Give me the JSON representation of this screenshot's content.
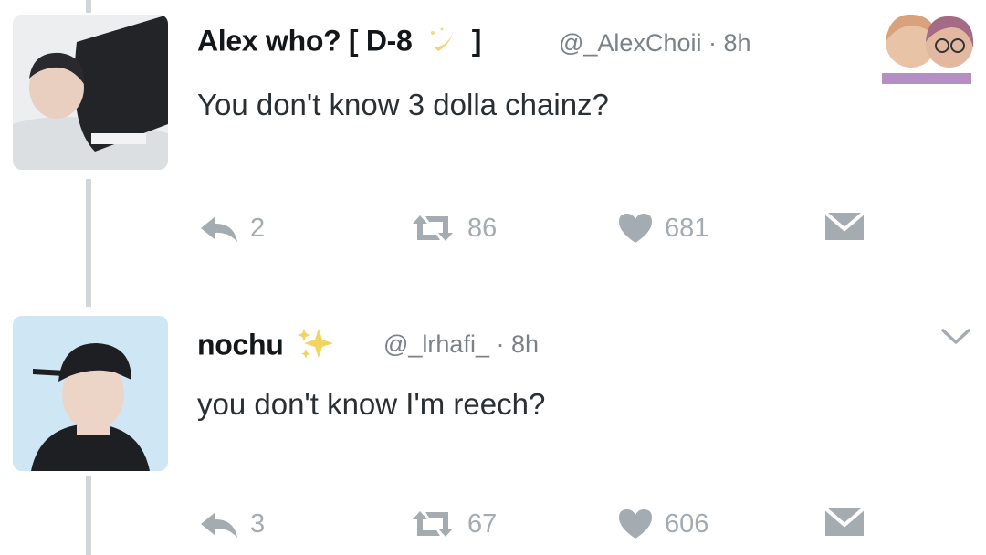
{
  "tweets": [
    {
      "display_name": "Alex who? [ D-8",
      "display_suffix": "]",
      "handle": "@_AlexChoii",
      "time": "· 8h",
      "text": "You don't know 3 dolla chainz?",
      "replies": "2",
      "retweets": "86",
      "likes": "681"
    },
    {
      "display_name": "nochu",
      "handle": "@_lrhafi_",
      "time": "· 8h",
      "text": "you don't know I'm reech?",
      "replies": "3",
      "retweets": "67",
      "likes": "606"
    }
  ],
  "icons": {
    "reply": "reply-arrow-icon",
    "retweet": "retweet-icon",
    "like": "heart-icon",
    "dm": "envelope-icon",
    "more": "chevron-down-icon",
    "badge1": "crescent-moon-emoji",
    "badge2": "sparkles-emoji"
  },
  "colors": {
    "text": "#14171a",
    "muted": "#7a8189",
    "icon": "#a4abb1",
    "thread_line": "#d2d6da"
  }
}
